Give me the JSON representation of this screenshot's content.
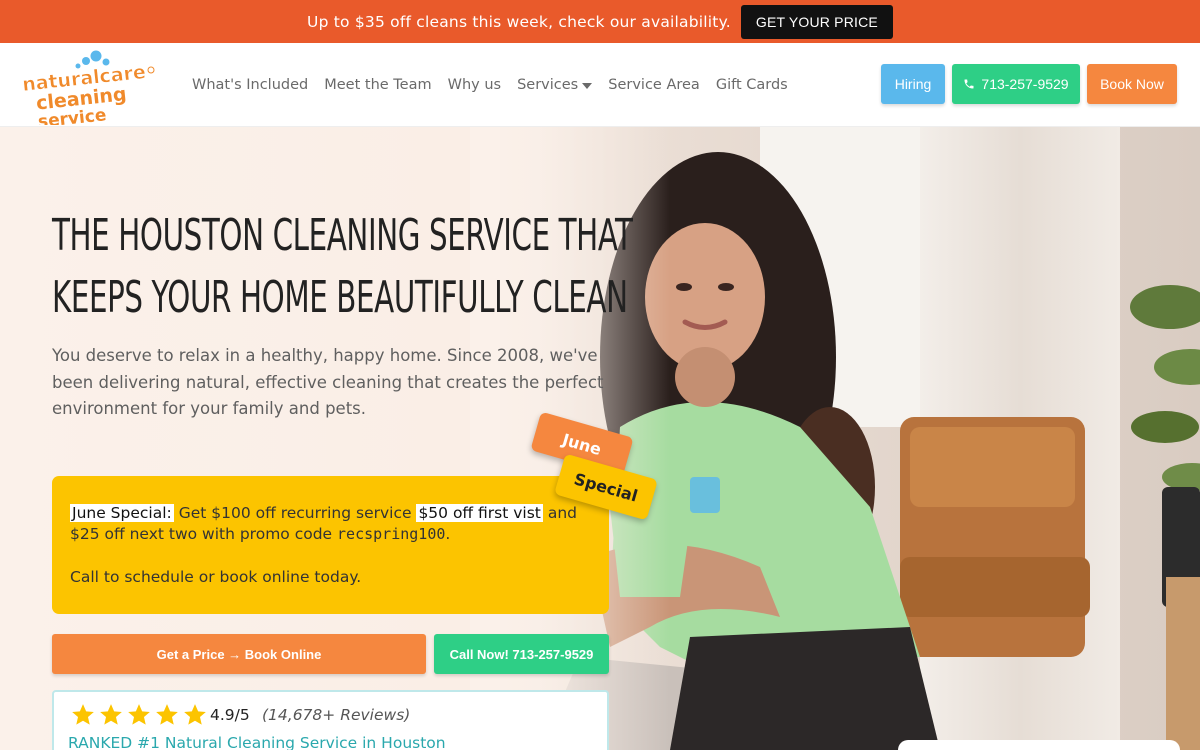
{
  "promo": {
    "text": "Up to $35 off cleans this week, check our availability.",
    "button": "GET YOUR PRICE"
  },
  "header": {
    "logo_alt": "naturalcare cleaning service",
    "nav": [
      {
        "label": "What's Included"
      },
      {
        "label": "Meet the Team"
      },
      {
        "label": "Why us"
      },
      {
        "label": "Services",
        "dropdown": true
      },
      {
        "label": "Service Area"
      },
      {
        "label": "Gift Cards"
      }
    ],
    "buttons": {
      "hiring": "Hiring",
      "phone": "713-257-9529",
      "book": "Book Now"
    }
  },
  "hero": {
    "headline_line1": "The Houston Cleaning Service That",
    "headline_line2": "Keeps Your Home Beautifully Clean",
    "subtext": "You deserve to relax in a healthy, happy home. Since 2008, we've been delivering natural, effective cleaning that creates the perfect environment for your family and pets.",
    "tag_june": "June",
    "tag_special": "Special"
  },
  "special": {
    "label": "June Special:",
    "part1": " Get $100 off recurring service ",
    "highlight": "$50 off first vist",
    "part2": " and $25 off next two with promo code ",
    "code": "recspring100",
    "part3": ".",
    "line2": "Call to schedule or book online today."
  },
  "cta": {
    "price": "Get a Price → Book Online",
    "call": "Call Now! 713-257-9529"
  },
  "reviews": {
    "stars": 5,
    "rating": "4.9/5",
    "count": "(14,678+ Reviews)",
    "ranked": "RANKED #1 Natural Cleaning Service in Houston"
  },
  "colors": {
    "promo_bg": "#e95a2b",
    "orange": "#f5873f",
    "green": "#2ecf86",
    "blue": "#5ab8ec",
    "yellow": "#fcc400",
    "teal": "#2aa8ad"
  }
}
